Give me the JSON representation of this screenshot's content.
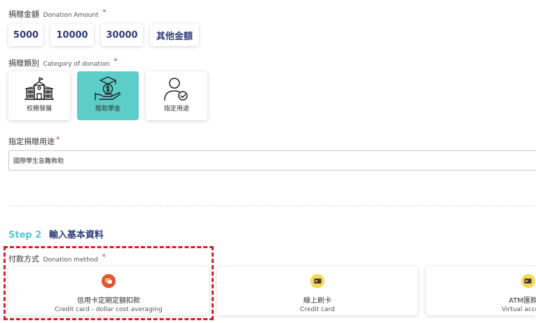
{
  "amount": {
    "label_zh": "捐贈金額",
    "label_en": "Donation Amount",
    "required_mark": "*",
    "options": [
      "5000",
      "10000",
      "30000",
      "其他金額"
    ]
  },
  "category": {
    "label_zh": "捐贈類別",
    "label_en": "Category of donation",
    "required_mark": "*",
    "items": [
      {
        "label": "校務發展",
        "icon": "school-building-icon"
      },
      {
        "label": "獎助學金",
        "icon": "scholarship-hand-coin-icon",
        "selected": true
      },
      {
        "label": "指定用途",
        "icon": "user-check-icon"
      }
    ]
  },
  "purpose": {
    "label": "指定捐贈用途",
    "required_mark": "*",
    "value": "國際學生急難救助"
  },
  "step2": {
    "number": "Step 2",
    "title": "輸入基本資料"
  },
  "payment": {
    "label_zh": "付款方式",
    "label_en": "Donation method",
    "required_mark": "*",
    "options": [
      {
        "zh": "信用卡定期定額扣款",
        "en": "Credit card - dollar cost averaging",
        "icon": "recurring-card-icon",
        "icon_color": "#e1562f"
      },
      {
        "zh": "線上刷卡",
        "en": "Credit card",
        "icon": "credit-card-icon",
        "icon_color": "#f6d75a"
      },
      {
        "zh": "ATM匯款(虛擬",
        "en": "Virtual acco",
        "icon": "atm-card-icon",
        "icon_color": "#f6d75a"
      }
    ]
  },
  "colors": {
    "accent_teal": "#5ccdc8",
    "navy": "#2f3e7a",
    "required_red": "#d9363e",
    "highlight_red": "#d4202a"
  }
}
